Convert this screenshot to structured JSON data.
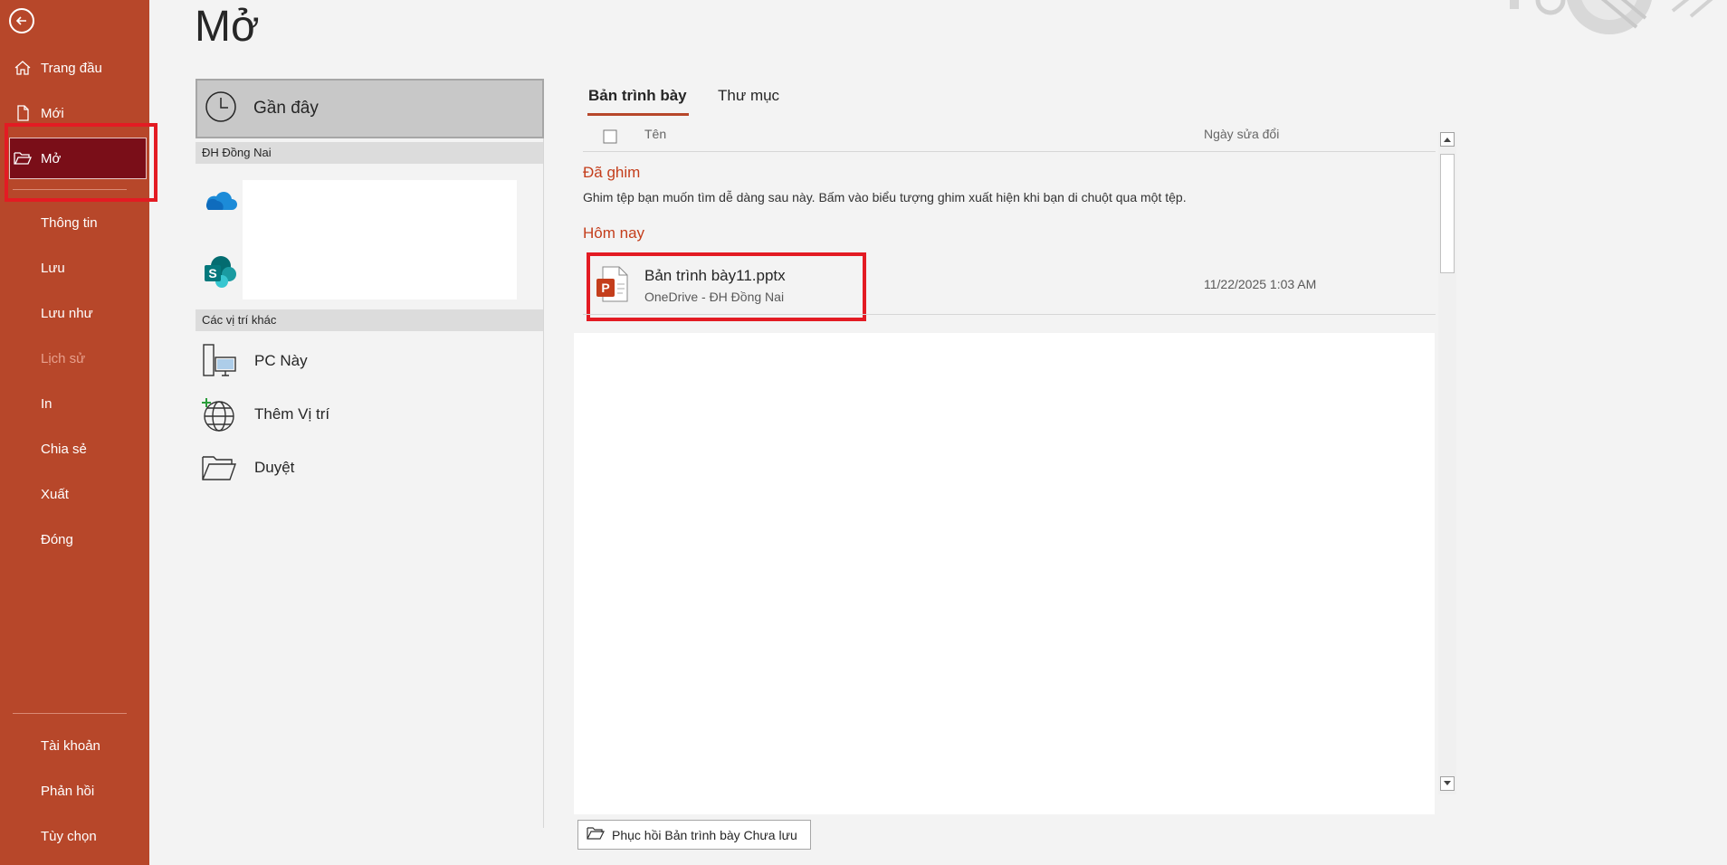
{
  "sidebar": {
    "items": [
      {
        "label": "Trang đầu",
        "icon": "home-icon"
      },
      {
        "label": "Mới",
        "icon": "new-file-icon"
      },
      {
        "label": "Mở",
        "icon": "folder-open-icon",
        "active": true
      },
      {
        "label": "Thông tin"
      },
      {
        "label": "Lưu"
      },
      {
        "label": "Lưu như"
      },
      {
        "label": "Lịch sử",
        "disabled": true
      },
      {
        "label": "In"
      },
      {
        "label": "Chia sẻ"
      },
      {
        "label": "Xuất"
      },
      {
        "label": "Đóng"
      }
    ],
    "bottom_items": [
      {
        "label": "Tài khoản"
      },
      {
        "label": "Phản hồi"
      },
      {
        "label": "Tùy chọn"
      }
    ]
  },
  "page": {
    "title": "Mở"
  },
  "locations": {
    "recent": {
      "label": "Gần đây"
    },
    "org_header": "ĐH Đồng Nai",
    "other_header": "Các vị trí khác",
    "other_items": [
      {
        "label": "PC Này",
        "icon": "pc-icon"
      },
      {
        "label": "Thêm Vị trí",
        "icon": "globe-add-icon"
      },
      {
        "label": "Duyệt",
        "icon": "folder-icon"
      }
    ]
  },
  "tabs": [
    {
      "label": "Bản trình bày",
      "active": true
    },
    {
      "label": "Thư mục"
    }
  ],
  "columns": {
    "name": "Tên",
    "modified": "Ngày sửa đổi"
  },
  "pinned": {
    "header": "Đã ghim",
    "description": "Ghim tệp bạn muốn tìm dễ dàng sau này. Bấm vào biểu tượng ghim xuất hiện khi bạn di chuột qua một tệp."
  },
  "today": {
    "header": "Hôm nay",
    "files": [
      {
        "name": "Bản trình bày11.pptx",
        "location": "OneDrive - ĐH Đồng Nai",
        "modified": "11/22/2025 1:03 AM"
      }
    ]
  },
  "recover_button": "Phục hồi Bản trình bày Chưa lưu",
  "colors": {
    "accent": "#b7472a",
    "active_nav": "#7a0e18",
    "highlight": "#e31b23"
  }
}
